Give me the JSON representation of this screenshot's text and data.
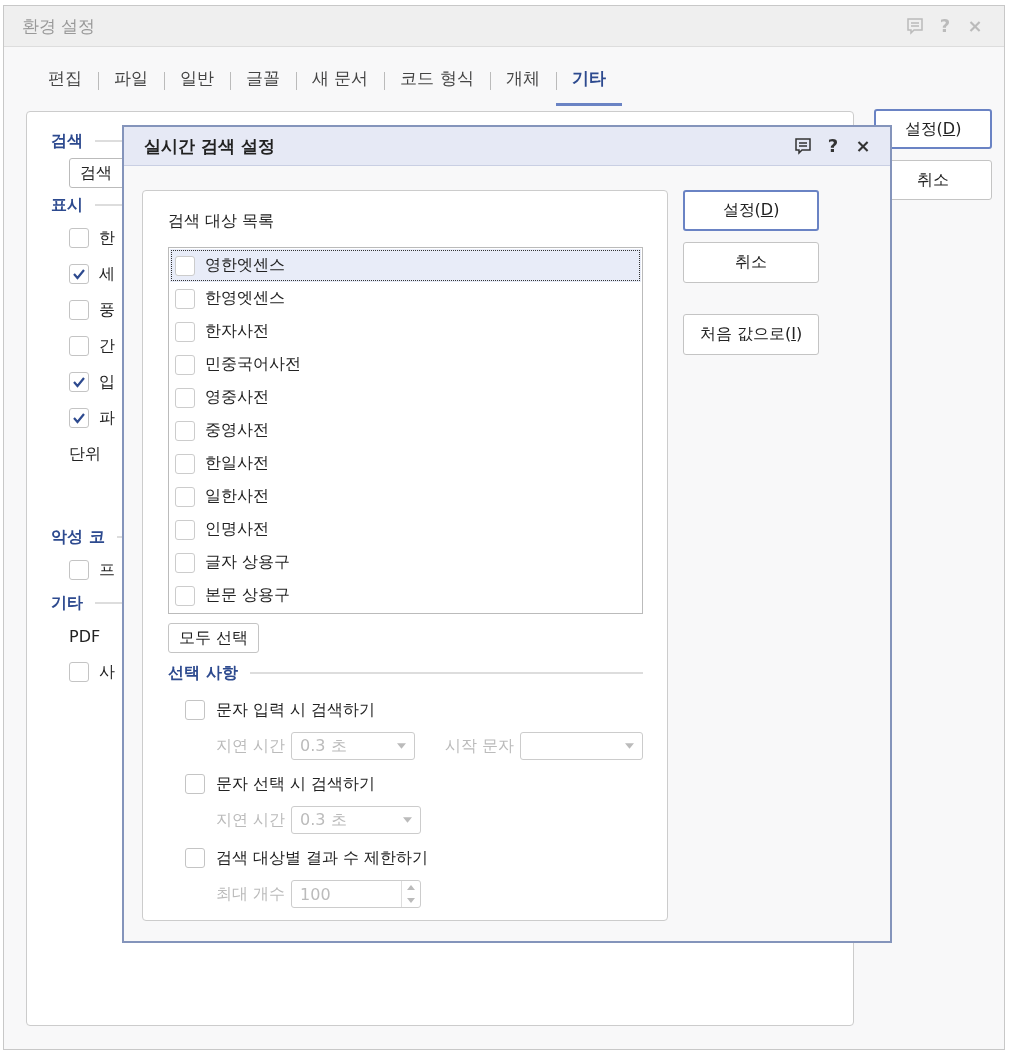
{
  "window": {
    "title": "환경 설정",
    "help": "?",
    "close": "×"
  },
  "tabs": [
    {
      "label": "편집",
      "selected": false
    },
    {
      "label": "파일",
      "selected": false
    },
    {
      "label": "일반",
      "selected": false
    },
    {
      "label": "글꼴",
      "selected": false
    },
    {
      "label": "새 문서",
      "selected": false
    },
    {
      "label": "코드 형식",
      "selected": false
    },
    {
      "label": "개체",
      "selected": false
    },
    {
      "label": "기타",
      "selected": true
    }
  ],
  "buttons": [
    {
      "text": "설정(",
      "hotkey": "D",
      "text_after": ")",
      "default": true
    },
    {
      "text": "취소",
      "default": false
    }
  ],
  "sections": [
    {
      "heading": "검색",
      "items": [
        {
          "kind": "combo",
          "text": "검색"
        }
      ]
    },
    {
      "heading": "표시",
      "items": [
        {
          "kind": "check",
          "checked": false,
          "text": "한"
        },
        {
          "kind": "check",
          "checked": true,
          "text": "세"
        },
        {
          "kind": "check",
          "checked": false,
          "text": "풍"
        },
        {
          "kind": "check",
          "checked": false,
          "text": "간"
        },
        {
          "kind": "check",
          "checked": true,
          "text": "입"
        },
        {
          "kind": "check",
          "checked": true,
          "text": "파"
        },
        {
          "kind": "text",
          "text": "단위"
        }
      ]
    },
    {
      "heading": "악성 코",
      "items": [
        {
          "kind": "check",
          "checked": false,
          "text": "프"
        }
      ]
    },
    {
      "heading": "기타",
      "items": [
        {
          "kind": "text",
          "text": "PDF"
        },
        {
          "kind": "check",
          "checked": false,
          "text": "사"
        }
      ]
    }
  ],
  "dialog": {
    "title": "실시간 검색 설정",
    "help": "?",
    "close": "×",
    "list_label": "검색 대상 목록",
    "targets": [
      {
        "label": "영한엣센스",
        "checked": false,
        "selected": true
      },
      {
        "label": "한영엣센스",
        "checked": false,
        "selected": false
      },
      {
        "label": "한자사전",
        "checked": false,
        "selected": false
      },
      {
        "label": "민중국어사전",
        "checked": false,
        "selected": false
      },
      {
        "label": "영중사전",
        "checked": false,
        "selected": false
      },
      {
        "label": "중영사전",
        "checked": false,
        "selected": false
      },
      {
        "label": "한일사전",
        "checked": false,
        "selected": false
      },
      {
        "label": "일한사전",
        "checked": false,
        "selected": false
      },
      {
        "label": "인명사전",
        "checked": false,
        "selected": false
      },
      {
        "label": "글자 상용구",
        "checked": false,
        "selected": false
      },
      {
        "label": "본문 상용구",
        "checked": false,
        "selected": false
      }
    ],
    "select_all": "모두 선택",
    "options_heading": "선택 사항",
    "options": [
      {
        "label": "문자 입력 시 검색하기",
        "checked": false,
        "fields": [
          {
            "kind": "select",
            "label": "지연 시간",
            "value": "0.3 초",
            "disabled": true
          },
          {
            "kind": "select",
            "label": "시작 문자",
            "disabled": true
          }
        ]
      },
      {
        "label": "문자 선택 시 검색하기",
        "checked": false,
        "fields": [
          {
            "kind": "select",
            "label": "지연 시간",
            "value": "0.3 초",
            "disabled": true
          }
        ]
      },
      {
        "label": "검색 대상별 결과 수 제한하기",
        "checked": false,
        "fields": [
          {
            "kind": "spin",
            "label": "최대 개수",
            "value": "100",
            "disabled": true
          }
        ]
      }
    ],
    "buttons": [
      {
        "text": "설정(",
        "hotkey": "D",
        "text_after": ")",
        "default": true
      },
      {
        "text": "취소",
        "default": false
      },
      {
        "text": "처음 값으로(",
        "hotkey": "I",
        "text_after": ")",
        "default": false
      }
    ]
  }
}
